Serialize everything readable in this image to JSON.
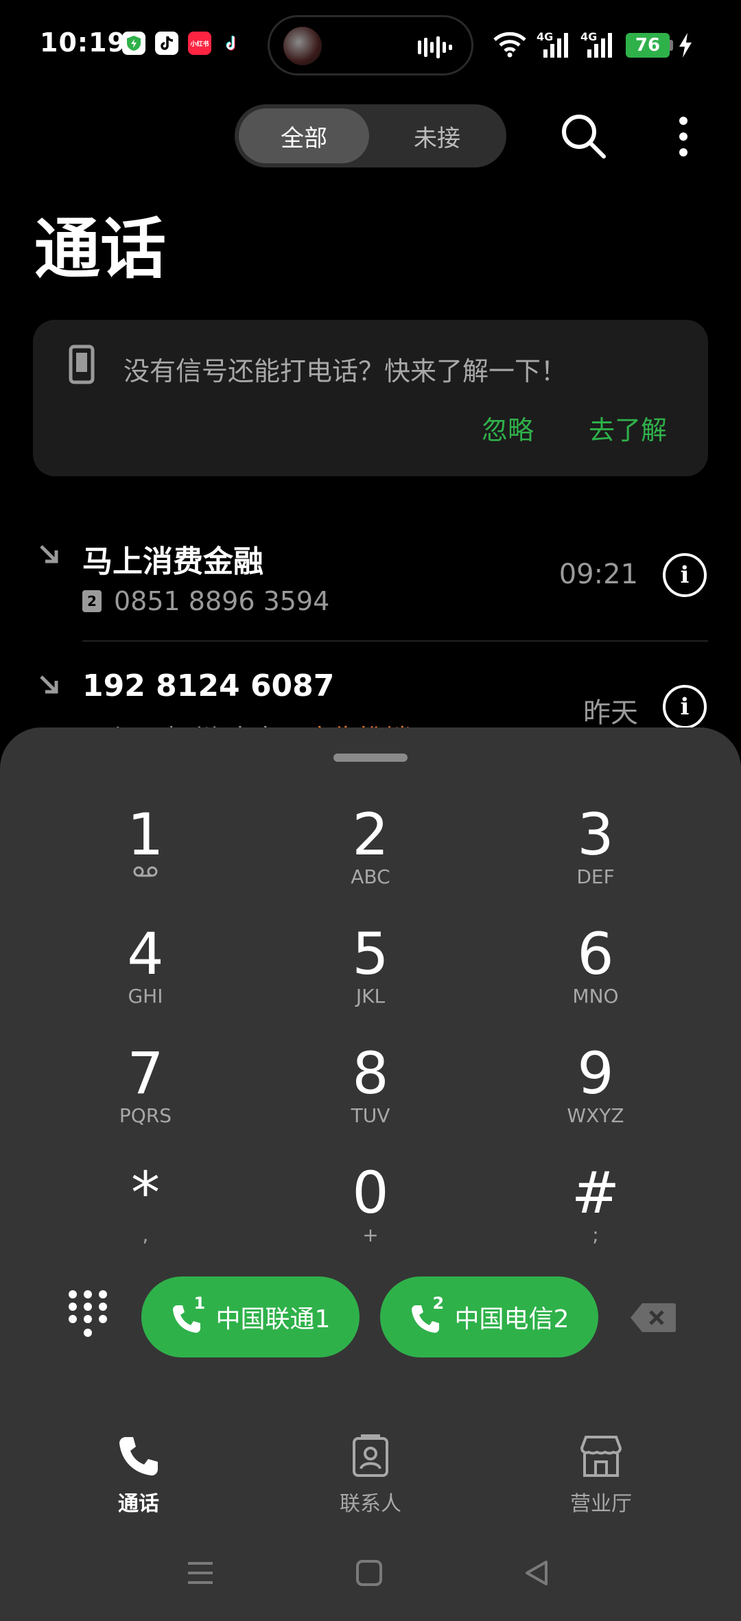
{
  "status_bar": {
    "time": "10:19",
    "apps": [
      {
        "name": "security-app-icon",
        "label": "",
        "color": "#2fb14a"
      },
      {
        "name": "tiktok-icon",
        "label": "",
        "color": "#ffffff"
      },
      {
        "name": "xiaohongshu-icon",
        "label": "小红书",
        "color": "#ff2442"
      },
      {
        "name": "tiktok-lite-icon",
        "label": "",
        "color": "#000000"
      }
    ],
    "network_left": "4G",
    "network_right": "4G",
    "battery": "76"
  },
  "tabs": {
    "all": "全部",
    "missed": "未接"
  },
  "page_title": "通话",
  "promo": {
    "text": "没有信号还能打电话？快来了解一下！",
    "ignore": "忽略",
    "learn": "去了解"
  },
  "calls": [
    {
      "name": "马上消费金融",
      "sim": "2",
      "number": "0851 8896 3594",
      "time": "09:21"
    },
    {
      "name": "192 8124 6087",
      "sim": "",
      "number": "江西抚州 广电",
      "tag": "广告推销",
      "time": "昨天"
    }
  ],
  "dialpad": {
    "keys": [
      {
        "digit": "1",
        "letters": "∞"
      },
      {
        "digit": "2",
        "letters": "ABC"
      },
      {
        "digit": "3",
        "letters": "DEF"
      },
      {
        "digit": "4",
        "letters": "GHI"
      },
      {
        "digit": "5",
        "letters": "JKL"
      },
      {
        "digit": "6",
        "letters": "MNO"
      },
      {
        "digit": "7",
        "letters": "PQRS"
      },
      {
        "digit": "8",
        "letters": "TUV"
      },
      {
        "digit": "9",
        "letters": "WXYZ"
      },
      {
        "digit": "*",
        "letters": ","
      },
      {
        "digit": "0",
        "letters": "+"
      },
      {
        "digit": "#",
        "letters": ";"
      }
    ],
    "sim1_label": "中国联通1",
    "sim1_badge": "1",
    "sim2_label": "中国电信2",
    "sim2_badge": "2"
  },
  "bottom_nav": {
    "calls": "通话",
    "contacts": "联系人",
    "store": "营业厅"
  },
  "colors": {
    "accent": "#2fb14a",
    "ad_tag": "#ff7a2a",
    "sheet": "#353535"
  }
}
